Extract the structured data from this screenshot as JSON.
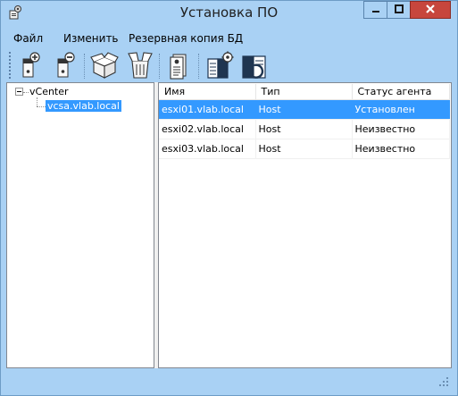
{
  "window": {
    "title": "Установка ПО",
    "icon": "installer-app-icon",
    "controls": [
      "minimize-icon",
      "maximize-icon",
      "close-icon"
    ]
  },
  "menu": {
    "items": [
      {
        "label": "Файл"
      },
      {
        "label": "Изменить"
      },
      {
        "label": "Резервная копия БД"
      }
    ]
  },
  "toolbar": {
    "buttons": [
      {
        "icon": "add-server-icon"
      },
      {
        "icon": "remove-server-icon"
      },
      {
        "icon": "open-box-icon"
      },
      {
        "icon": "unpack-box-icon"
      },
      {
        "icon": "document-icon"
      },
      {
        "icon": "settings-book-icon"
      },
      {
        "icon": "refresh-book-icon"
      }
    ]
  },
  "tree": {
    "root": {
      "label": "vCenter"
    },
    "child": {
      "label": "vcsa.vlab.local",
      "selected": true
    }
  },
  "table": {
    "columns": [
      "Имя",
      "Тип",
      "Статус агента"
    ],
    "rows": [
      {
        "name": "esxi01.vlab.local",
        "type": "Host",
        "status": "Установлен",
        "selected": true
      },
      {
        "name": "esxi02.vlab.local",
        "type": "Host",
        "status": "Неизвестно",
        "selected": false
      },
      {
        "name": "esxi03.vlab.local",
        "type": "Host",
        "status": "Неизвестно",
        "selected": false
      }
    ]
  },
  "colors": {
    "chrome": "#a9d1f4",
    "selection": "#3399ff",
    "close_button": "#c7463d"
  }
}
